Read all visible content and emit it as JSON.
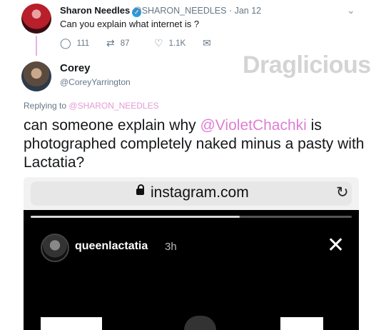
{
  "parent_tweet": {
    "name": "Sharon Needles",
    "handle": "@SHARON_NEEDLES",
    "date": "· Jan 12",
    "text": "Can you explain what internet is ?",
    "replies": "111",
    "retweets": "87",
    "likes": "1.1K"
  },
  "reply_tweet": {
    "name": "Corey",
    "handle": "@CoreyYarrington",
    "replying_prefix": "Replying to",
    "replying_to": "@SHARON_NEEDLES",
    "text_before": "can someone explain why ",
    "mention": "@VioletChachki",
    "text_after": " is photographed completely naked minus a pasty with Lactatia?"
  },
  "watermark": "Draglicious",
  "embedded": {
    "url": "instagram.com",
    "story_user": "queenlactatia",
    "story_time": "3h",
    "story_progress": 0.65
  }
}
